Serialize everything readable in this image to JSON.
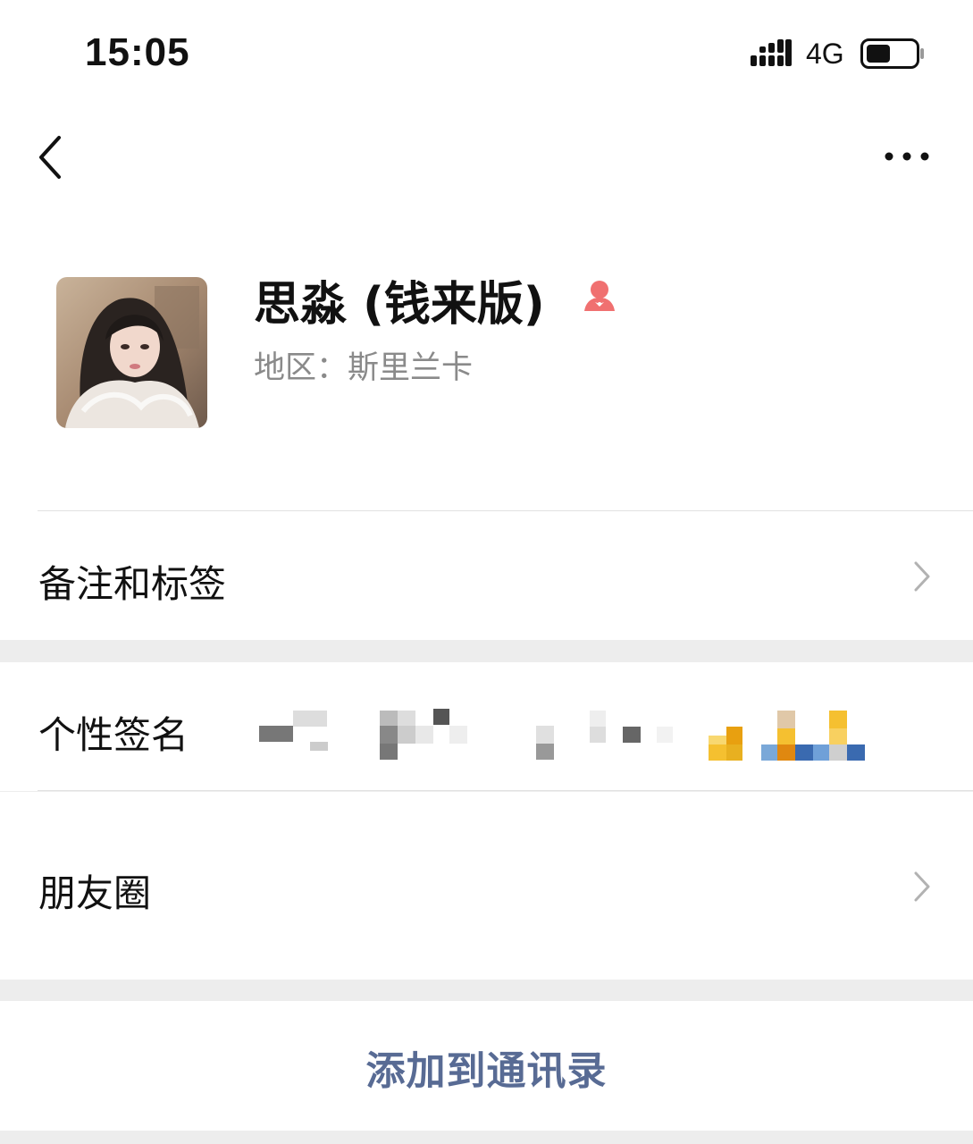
{
  "status_bar": {
    "time": "15:05",
    "network": "4G",
    "battery_level": 0.5
  },
  "profile": {
    "name": "思淼 (钱来版)",
    "region": "地区：斯里兰卡",
    "gender_icon": "female-icon",
    "gender_color": "#f07070"
  },
  "rows": {
    "remarks_label": "备注和标签",
    "signature_label": "个性签名",
    "moments_label": "朋友圈"
  },
  "actions": {
    "add_to_contacts": "添加到通讯录"
  },
  "colors": {
    "link_blue": "#586b94",
    "background": "#ededed"
  }
}
